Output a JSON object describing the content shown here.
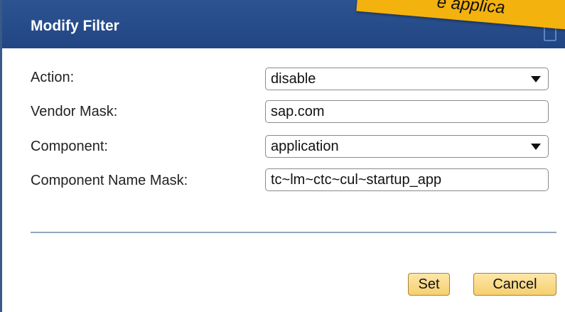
{
  "dialog": {
    "title": "Modify Filter",
    "banner_text": "e applica"
  },
  "form": {
    "action": {
      "label": "Action:",
      "value": "disable"
    },
    "vendor_mask": {
      "label": "Vendor Mask:",
      "value": "sap.com"
    },
    "component": {
      "label": "Component:",
      "value": "application"
    },
    "component_name_mask": {
      "label": "Component Name Mask:",
      "value": "tc~lm~ctc~cul~startup_app"
    }
  },
  "buttons": {
    "set": "Set",
    "cancel": "Cancel"
  },
  "colors": {
    "title_bar": "#224583",
    "banner": "#f4b20f",
    "button": "#f6cf6f"
  }
}
